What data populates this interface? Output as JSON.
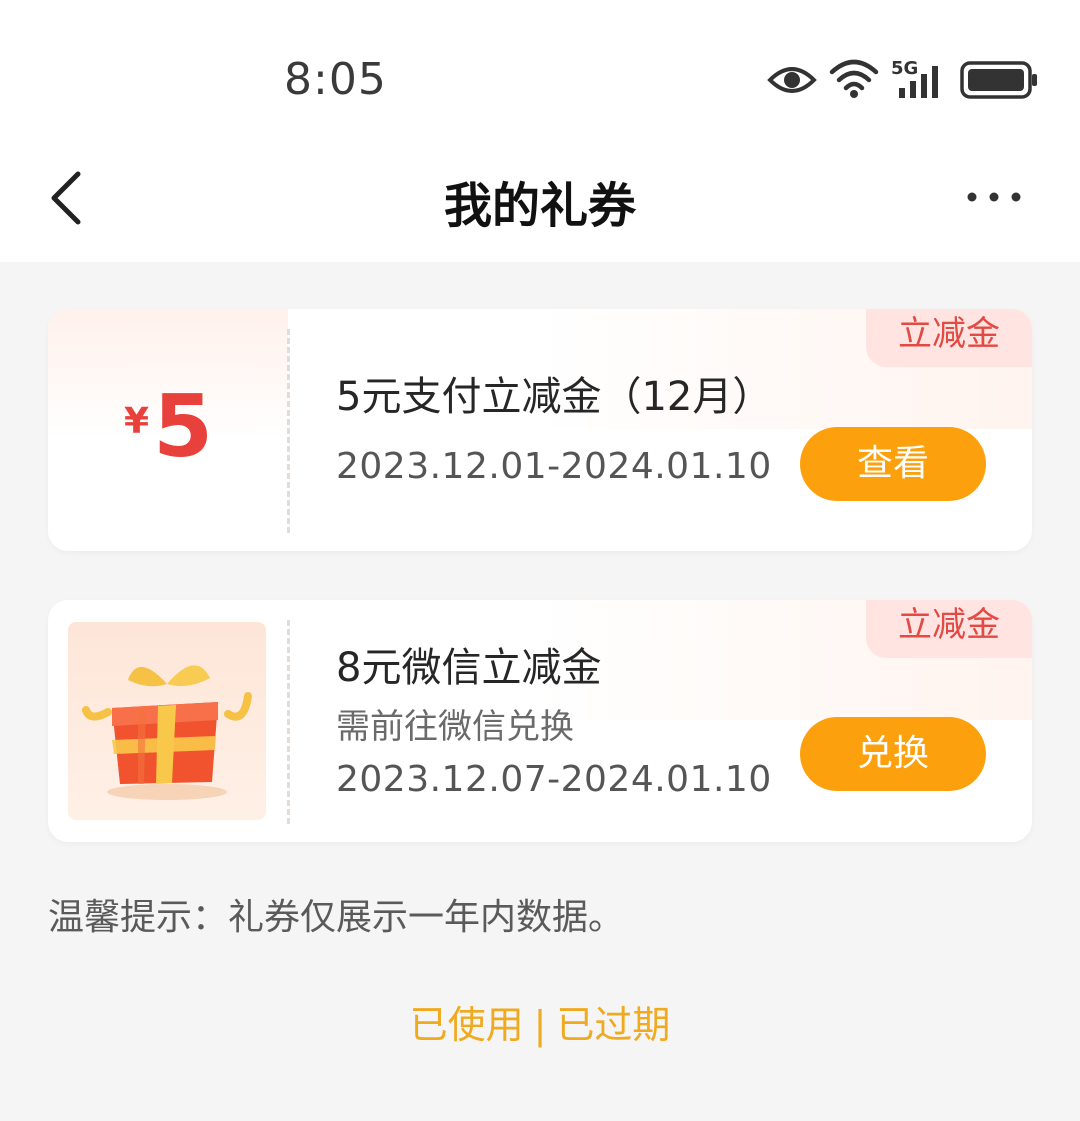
{
  "status_bar": {
    "time": "8:05",
    "network_label": "5G",
    "icons": [
      "eye-icon",
      "wifi-icon",
      "signal-icon",
      "battery-icon"
    ]
  },
  "nav": {
    "title": "我的礼券",
    "back_icon": "chevron-left-icon",
    "more_icon": "more-icon"
  },
  "coupons": [
    {
      "tag": "立减金",
      "currency": "¥",
      "amount": "5",
      "title": "5元支付立减金（12月）",
      "date_range": "2023.12.01-2024.01.10",
      "button": "查看"
    },
    {
      "tag": "立减金",
      "image": "gift-box-icon",
      "title": "8元微信立减金",
      "subtitle": "需前往微信兑换",
      "date_range": "2023.12.07-2024.01.10",
      "button": "兑换"
    }
  ],
  "tip": "温馨提示：礼券仅展示一年内数据。",
  "footer_links": {
    "used": "已使用",
    "separator": "|",
    "expired": "已过期"
  },
  "colors": {
    "accent": "#fca10d",
    "tag_text": "#e24a44",
    "amount": "#e8403a",
    "link": "#f0aa1f"
  }
}
